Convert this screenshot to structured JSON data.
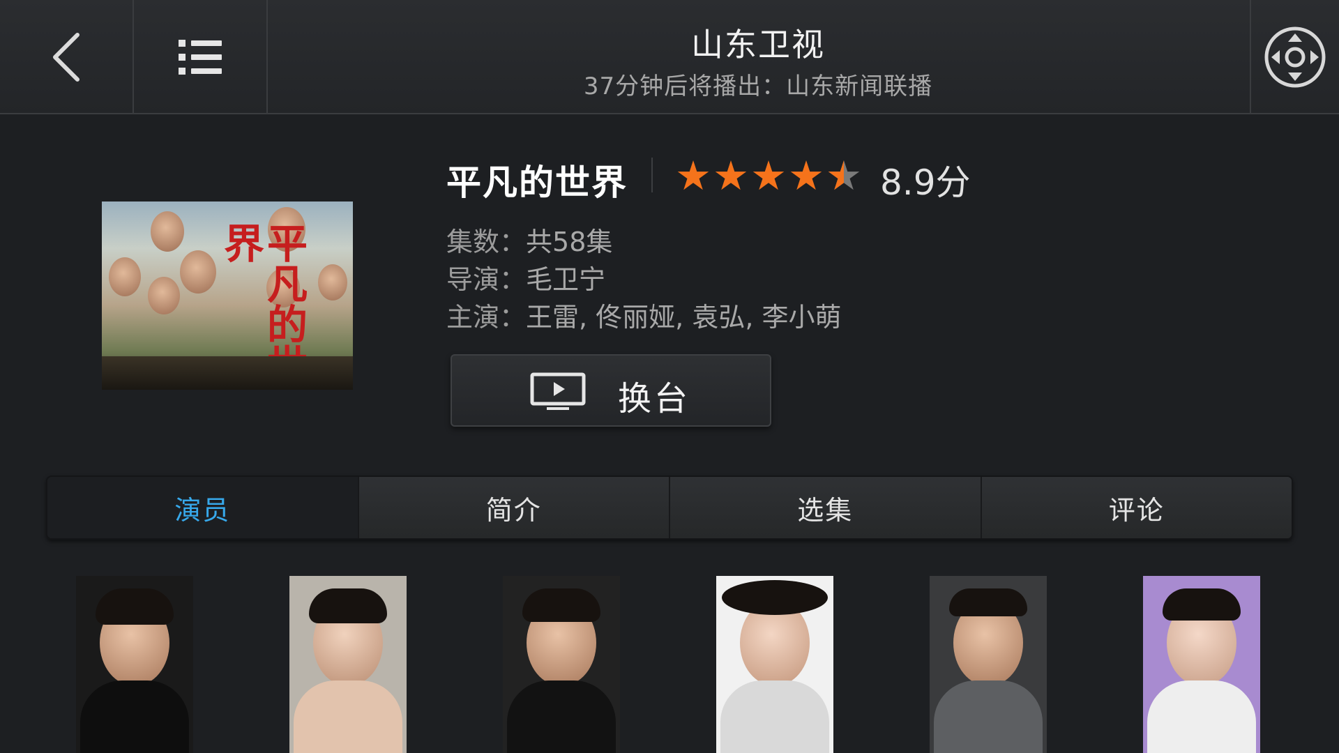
{
  "header": {
    "channel_name": "山东卫视",
    "next_program": "37分钟后将播出：山东新闻联播"
  },
  "show": {
    "title": "平凡的世界",
    "rating_stars": 4.5,
    "score_text": "8.9分",
    "poster_title": "平凡的世界",
    "episodes_label": "集数：",
    "episodes_value": "共58集",
    "director_label": "导演：",
    "director_value": "毛卫宁",
    "cast_label": "主演：",
    "cast_value": "王雷, 佟丽娅, 袁弘, 李小萌"
  },
  "switch_button": {
    "label": "换台",
    "icon": "tv-play-icon"
  },
  "tabs": [
    {
      "label": "演员",
      "active": true
    },
    {
      "label": "简介",
      "active": false
    },
    {
      "label": "选集",
      "active": false
    },
    {
      "label": "评论",
      "active": false
    }
  ],
  "cast_photos": [
    "actor-photo",
    "actor-photo",
    "actor-photo",
    "actor-photo",
    "actor-photo",
    "actor-photo"
  ],
  "colors": {
    "accent": "#37a8ea",
    "star": "#f5731b",
    "background": "#1d1f22"
  }
}
